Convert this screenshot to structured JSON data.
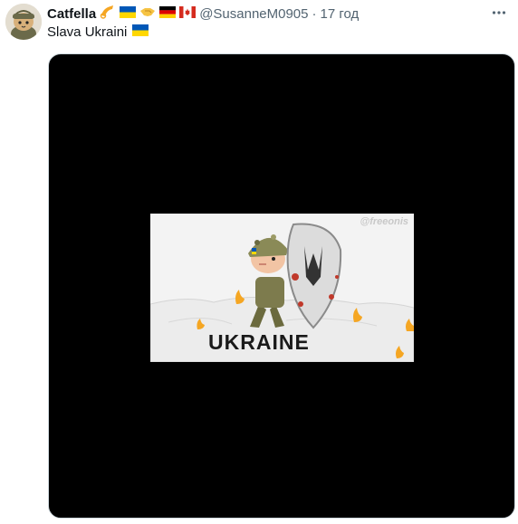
{
  "tweet": {
    "author_name": "Catfella",
    "author_handle": "@SusanneM0905",
    "separator": "·",
    "timestamp": "17 год",
    "text": "Slava Ukraini",
    "badge_icons": [
      "horn-emoji",
      "ukraine-flag-emoji",
      "handshake-emoji",
      "germany-flag-emoji",
      "canada-flag-emoji"
    ],
    "text_icon": "ukraine-flag-emoji"
  },
  "media": {
    "watermark": "@freeonis",
    "caption_word": "UKRAINE"
  },
  "colors": {
    "muted": "#536471",
    "media_background": "#000000",
    "ukraine_blue": "#0057b7",
    "ukraine_yellow": "#ffd700"
  }
}
